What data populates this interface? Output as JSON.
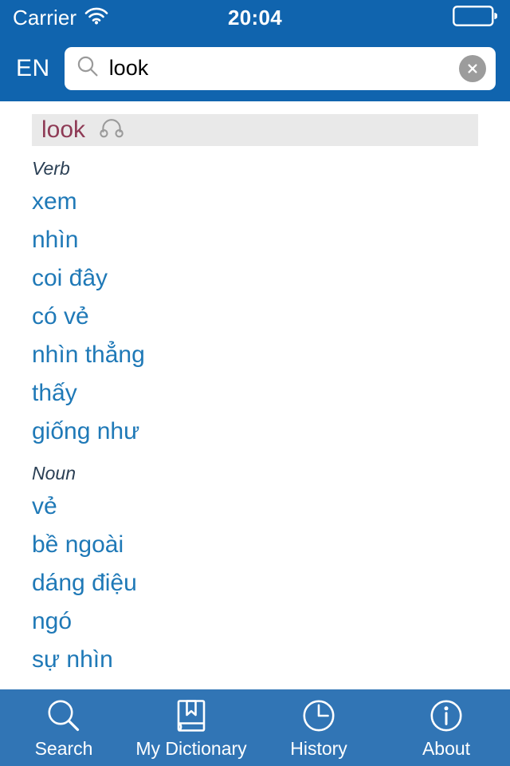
{
  "status_bar": {
    "carrier": "Carrier",
    "wifi_icon": "wifi-icon",
    "time": "20:04",
    "battery_icon": "battery-icon"
  },
  "search_header": {
    "language_label": "EN",
    "search_icon": "search-icon",
    "query": "look",
    "placeholder": "Search",
    "clear_icon": "clear-circle-icon"
  },
  "entry": {
    "headword": "look",
    "speak_icon": "headphones-icon",
    "sections": [
      {
        "part_of_speech": "Verb",
        "translations": [
          "xem",
          "nhìn",
          "coi đây",
          "có vẻ",
          "nhìn thẳng",
          "thấy",
          "giống như"
        ]
      },
      {
        "part_of_speech": "Noun",
        "translations": [
          "vẻ",
          "bề ngoài",
          "dáng điệu",
          "ngó",
          "sự nhìn"
        ]
      }
    ]
  },
  "tab_bar": {
    "items": [
      {
        "label": "Search",
        "icon": "magnifier-icon"
      },
      {
        "label": "My Dictionary",
        "icon": "book-bookmark-icon"
      },
      {
        "label": "History",
        "icon": "clock-icon"
      },
      {
        "label": "About",
        "icon": "info-circle-icon"
      }
    ]
  },
  "colors": {
    "header_blue": "#1064AE",
    "tabbar_blue": "#3175B5",
    "headword_maroon": "#8E3A55",
    "translation_blue": "#1F79B7",
    "pos_slate": "#2A3F54",
    "headword_row_gray": "#E9E9E9",
    "clear_button_gray": "#9C9C9C"
  }
}
